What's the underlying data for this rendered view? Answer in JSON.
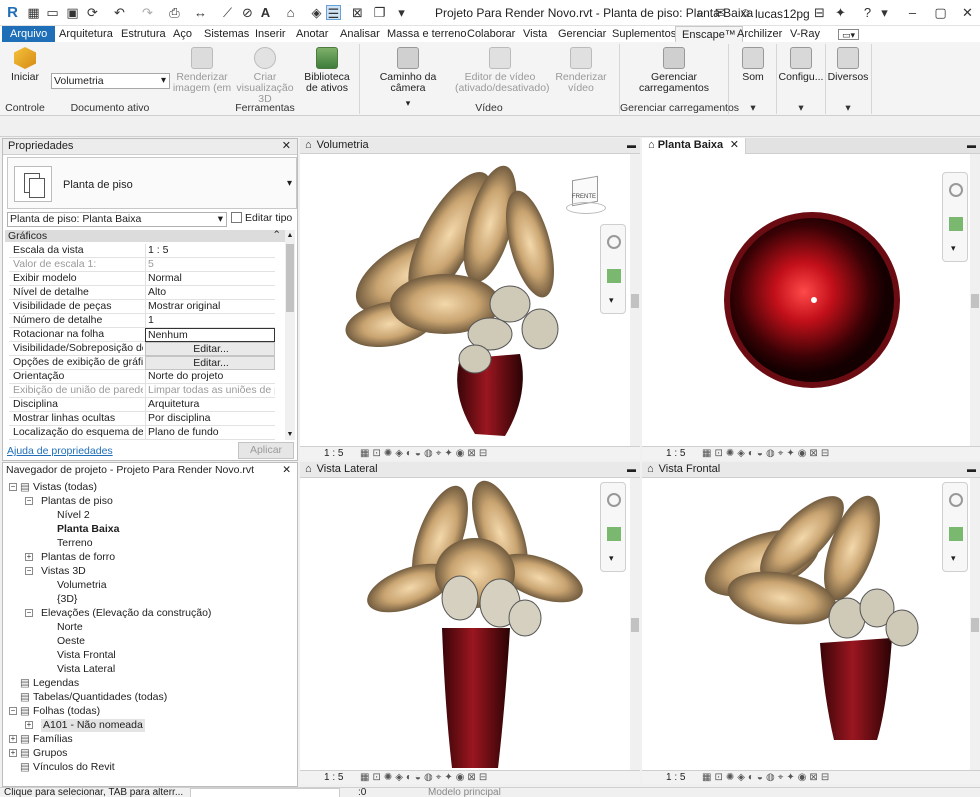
{
  "titlebar": {
    "title": "Projeto Para Render Novo.rvt - Planta de piso: Planta Baixa",
    "user": "lucas12pg"
  },
  "menu": [
    "Arquivo",
    "Arquitetura",
    "Estrutura",
    "Aço",
    "Sistemas",
    "Inserir",
    "Anotar",
    "Analisar",
    "Massa e terreno",
    "Colaborar",
    "Vista",
    "Gerenciar",
    "Suplementos",
    "Enscape™",
    "Archilizer",
    "V-Ray"
  ],
  "ribbon": {
    "iniciar": "Iniciar",
    "doc_select": "Volumetria",
    "renderizar_imagem": "Renderizar imagem (em",
    "criar_visualizacao": "Criar visualização 3D",
    "biblioteca": "Biblioteca de ativos",
    "caminho": "Caminho da câmera",
    "editor_video": "Editor de vídeo (ativado/desativado)",
    "renderizar_video": "Renderizar vídeo",
    "gerenciar_carregamentos": "Gerenciar carregamentos",
    "som": "Som",
    "configu": "Configu...",
    "diversos": "Diversos",
    "grp_controle": "Controle",
    "grp_documento": "Documento ativo",
    "grp_ferramentas": "Ferramentas",
    "grp_video": "Vídeo",
    "grp_gerenciar": "Gerenciar carregamentos"
  },
  "properties": {
    "title": "Propriedades",
    "type_name": "Planta de piso",
    "instance": "Planta de piso: Planta Baixa",
    "edit_type": "Editar tipo",
    "section": "Gráficos",
    "rows": [
      {
        "k": "Escala da vista",
        "v": "1 : 5"
      },
      {
        "k": "Valor de escala    1:",
        "v": "5"
      },
      {
        "k": "Exibir modelo",
        "v": "Normal"
      },
      {
        "k": "Nível de detalhe",
        "v": "Alto"
      },
      {
        "k": "Visibilidade de peças",
        "v": "Mostrar original"
      },
      {
        "k": "Número de detalhe",
        "v": "1"
      },
      {
        "k": "Rotacionar na folha",
        "v": "Nenhum"
      },
      {
        "k": "Visibilidade/Sobreposição de ...",
        "v": "Editar..."
      },
      {
        "k": "Opções de exibição de gráficos",
        "v": "Editar..."
      },
      {
        "k": "Orientação",
        "v": "Norte do projeto"
      },
      {
        "k": "Exibição de união de parede",
        "v": "Limpar todas as uniões de par..."
      },
      {
        "k": "Disciplina",
        "v": "Arquitetura"
      },
      {
        "k": "Mostrar linhas ocultas",
        "v": "Por disciplina"
      },
      {
        "k": "Localização do esquema de cor",
        "v": "Plano de fundo"
      }
    ],
    "help": "Ajuda de propriedades",
    "apply": "Aplicar"
  },
  "browser": {
    "title": "Navegador de projeto - Projeto Para Render Novo.rvt",
    "nodes": [
      {
        "label": "Vistas (todas)",
        "bold": false
      },
      {
        "label": "Plantas de piso",
        "bold": false
      },
      {
        "label": "Nível 2",
        "bold": false
      },
      {
        "label": "Planta Baixa",
        "bold": true
      },
      {
        "label": "Terreno",
        "bold": false
      },
      {
        "label": "Plantas de forro",
        "bold": false
      },
      {
        "label": "Vistas 3D",
        "bold": false
      },
      {
        "label": "Volumetria",
        "bold": false
      },
      {
        "label": "{3D}",
        "bold": false
      },
      {
        "label": "Elevações (Elevação da construção)",
        "bold": false
      },
      {
        "label": "Norte",
        "bold": false
      },
      {
        "label": "Oeste",
        "bold": false
      },
      {
        "label": "Vista Frontal",
        "bold": false
      },
      {
        "label": "Vista Lateral",
        "bold": false
      },
      {
        "label": "Legendas",
        "bold": false
      },
      {
        "label": "Tabelas/Quantidades (todas)",
        "bold": false
      },
      {
        "label": "Folhas (todas)",
        "bold": false
      },
      {
        "label": "A101 - Não nomeada",
        "bold": false
      },
      {
        "label": "Famílias",
        "bold": false
      },
      {
        "label": "Grupos",
        "bold": false
      },
      {
        "label": "Vínculos do Revit",
        "bold": false
      }
    ]
  },
  "views": {
    "volumetria": "Volumetria",
    "planta": "Planta Baixa",
    "lateral": "Vista Lateral",
    "frontal": "Vista Frontal",
    "scale": "1 : 5",
    "viewcube_label": "FRENTE"
  },
  "status": {
    "hint": "Clique para selecionar, TAB para alterr...",
    "count": ":0",
    "model": "Modelo principal"
  },
  "colors": {
    "accent": "#1f6fb8",
    "vase": "#6b0c12"
  }
}
